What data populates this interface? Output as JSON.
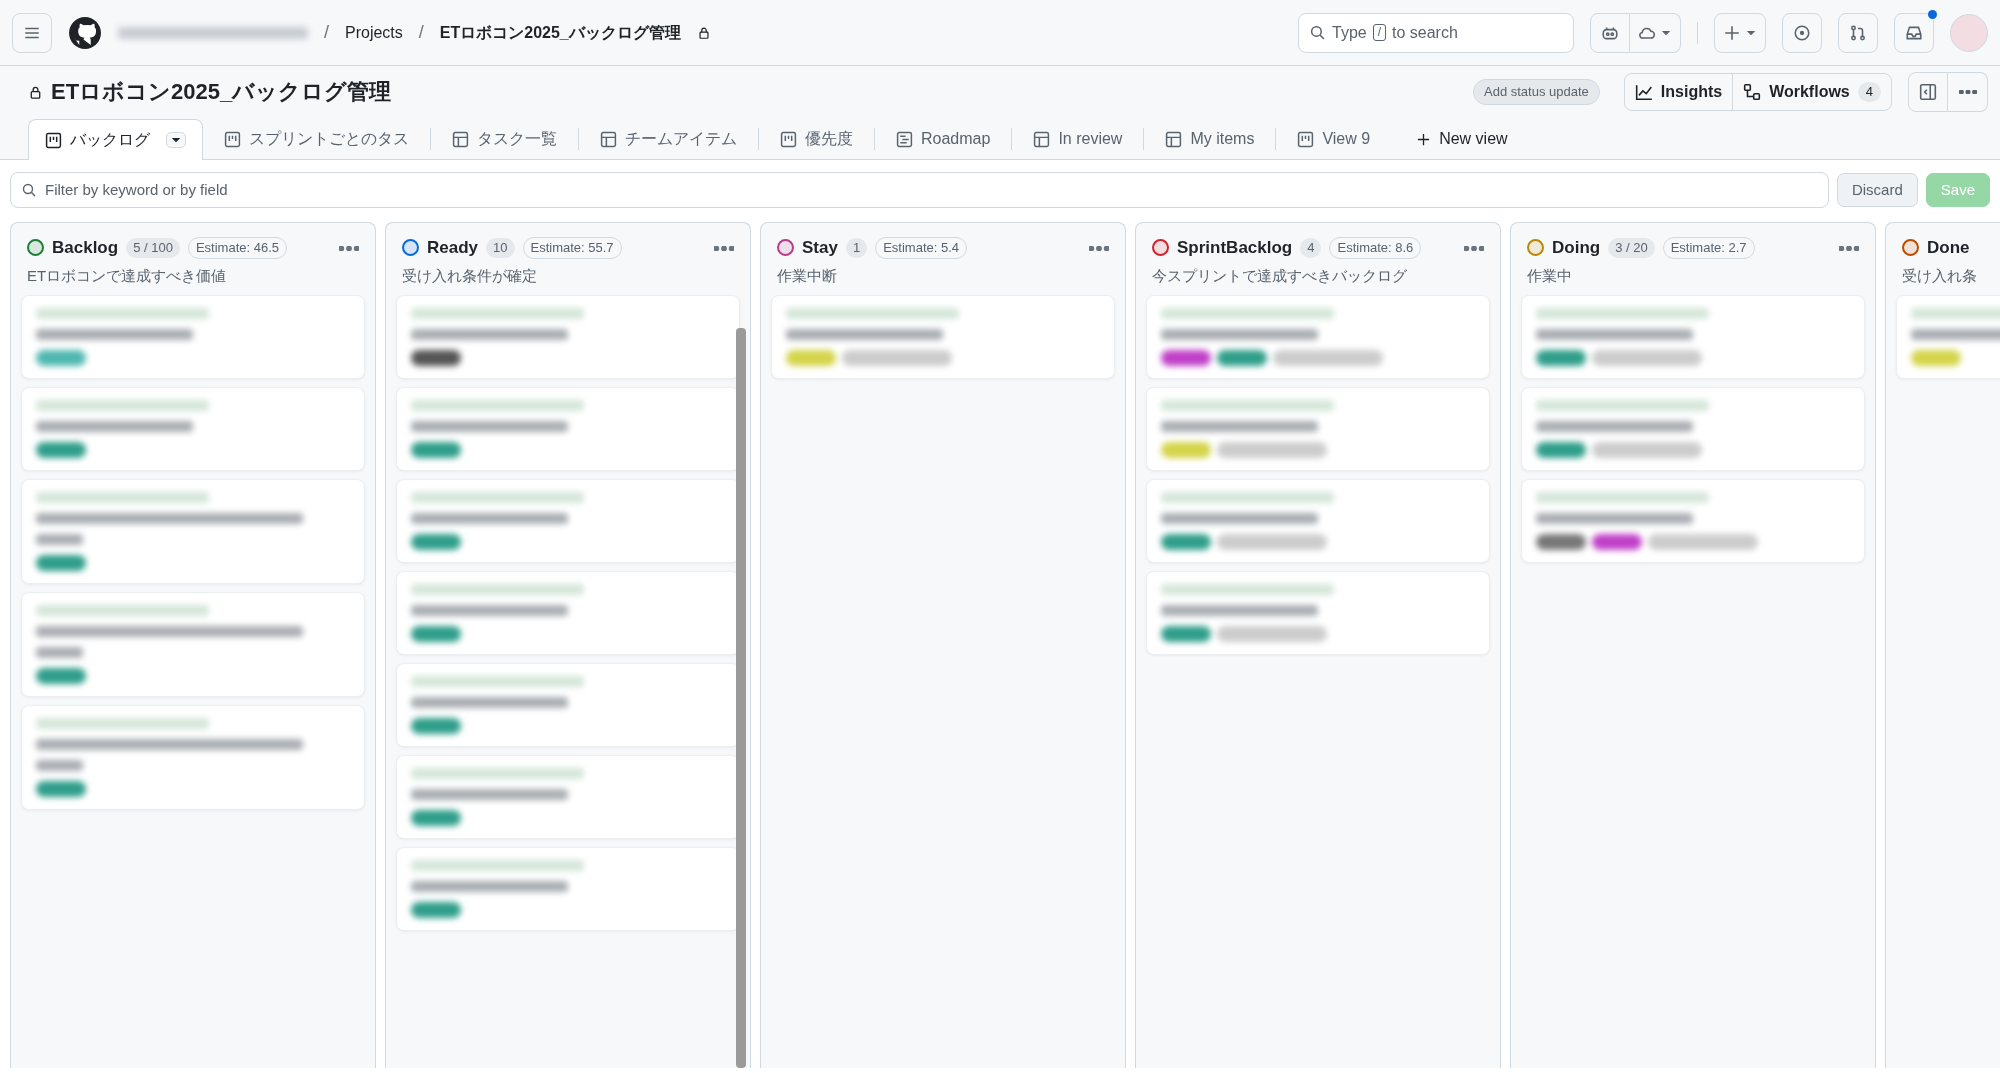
{
  "topbar": {
    "separator": "/",
    "breadcrumb": [
      "Projects",
      "ETロボコン2025_バックログ管理"
    ],
    "search": {
      "before": "Type",
      "key": "/",
      "after": "to search"
    },
    "inbox_unread": true
  },
  "project": {
    "title": "ETロボコン2025_バックログ管理",
    "status_button": "Add status update",
    "insights": "Insights",
    "workflows": {
      "label": "Workflows",
      "count": "4"
    }
  },
  "tabs": [
    {
      "label": "バックログ",
      "kind": "board",
      "selected": true
    },
    {
      "label": "スプリントごとのタス",
      "kind": "board",
      "selected": false
    },
    {
      "label": "タスク一覧",
      "kind": "table",
      "selected": false
    },
    {
      "label": "チームアイテム",
      "kind": "table",
      "selected": false
    },
    {
      "label": "優先度",
      "kind": "board",
      "selected": false
    },
    {
      "label": "Roadmap",
      "kind": "roadmap",
      "selected": false
    },
    {
      "label": "In review",
      "kind": "table",
      "selected": false
    },
    {
      "label": "My items",
      "kind": "table",
      "selected": false
    },
    {
      "label": "View 9",
      "kind": "board",
      "selected": false
    }
  ],
  "new_view": "New view",
  "filter": {
    "placeholder": "Filter by keyword or by field",
    "discard": "Discard",
    "save": "Save",
    "save_disabled": true
  },
  "columns": [
    {
      "name": "Backlog",
      "color": "#1a7f37",
      "count": "5 / 100",
      "estimate": "Estimate: 46.5",
      "description": "ETロボコンで達成すべき価値",
      "cards": [
        {
          "kind": "short",
          "tags": [
            {
              "color": "#4fb8b0"
            }
          ]
        },
        {
          "kind": "short",
          "tags": [
            {
              "color": "#2f9e8a"
            }
          ]
        },
        {
          "kind": "long",
          "tags": [
            {
              "color": "#2f9e8a"
            }
          ]
        },
        {
          "kind": "long",
          "tags": [
            {
              "color": "#2f9e8a"
            }
          ]
        },
        {
          "kind": "long",
          "tags": [
            {
              "color": "#2f9e8a"
            }
          ]
        }
      ]
    },
    {
      "name": "Ready",
      "color": "#0969da",
      "count": "10",
      "estimate": "Estimate: 55.7",
      "description": "受け入れ条件が確定",
      "cards": [
        {
          "kind": "short",
          "tags": [
            {
              "color": "#555555"
            }
          ]
        },
        {
          "kind": "short",
          "tags": [
            {
              "color": "#2f9e8a"
            }
          ]
        },
        {
          "kind": "short",
          "tags": [
            {
              "color": "#2f9e8a"
            }
          ]
        },
        {
          "kind": "short",
          "tags": [
            {
              "color": "#2f9e8a"
            }
          ]
        },
        {
          "kind": "short",
          "tags": [
            {
              "color": "#2f9e8a"
            }
          ]
        },
        {
          "kind": "short",
          "tags": [
            {
              "color": "#2f9e8a"
            }
          ]
        },
        {
          "kind": "short",
          "tags": [
            {
              "color": "#2f9e8a"
            }
          ]
        }
      ]
    },
    {
      "name": "Stay",
      "color": "#bf3989",
      "count": "1",
      "estimate": "Estimate: 5.4",
      "description": "作業中断",
      "cards": [
        {
          "kind": "short",
          "tags": [
            {
              "color": "#d4d44a"
            },
            {
              "color": "#cccccc"
            }
          ]
        }
      ]
    },
    {
      "name": "SprintBacklog",
      "color": "#cf222e",
      "count": "4",
      "estimate": "Estimate: 8.6",
      "description": "今スプリントで達成すべきバックログ",
      "cards": [
        {
          "kind": "short",
          "tags": [
            {
              "color": "#c040c8"
            },
            {
              "color": "#2f9e8a"
            },
            {
              "color": "#cccccc"
            }
          ]
        },
        {
          "kind": "short",
          "tags": [
            {
              "color": "#d4d44a"
            },
            {
              "color": "#cccccc"
            }
          ]
        },
        {
          "kind": "short",
          "tags": [
            {
              "color": "#2f9e8a"
            },
            {
              "color": "#cccccc"
            }
          ]
        },
        {
          "kind": "short",
          "tags": [
            {
              "color": "#2f9e8a"
            },
            {
              "color": "#cccccc"
            }
          ]
        }
      ]
    },
    {
      "name": "Doing",
      "color": "#bf8700",
      "count": "3 / 20",
      "estimate": "Estimate: 2.7",
      "description": "作業中",
      "cards": [
        {
          "kind": "short",
          "tags": [
            {
              "color": "#2f9e8a"
            },
            {
              "color": "#cccccc"
            }
          ]
        },
        {
          "kind": "short",
          "tags": [
            {
              "color": "#2f9e8a"
            },
            {
              "color": "#cccccc"
            }
          ]
        },
        {
          "kind": "short",
          "tags": [
            {
              "color": "#777777"
            },
            {
              "color": "#c040c8"
            },
            {
              "color": "#cccccc"
            }
          ]
        }
      ]
    },
    {
      "name": "Done",
      "color": "#bc4c00",
      "description": "受け入れ条",
      "cards": [
        {
          "kind": "short",
          "tags": [
            {
              "color": "#d4d44a"
            }
          ]
        }
      ]
    }
  ]
}
